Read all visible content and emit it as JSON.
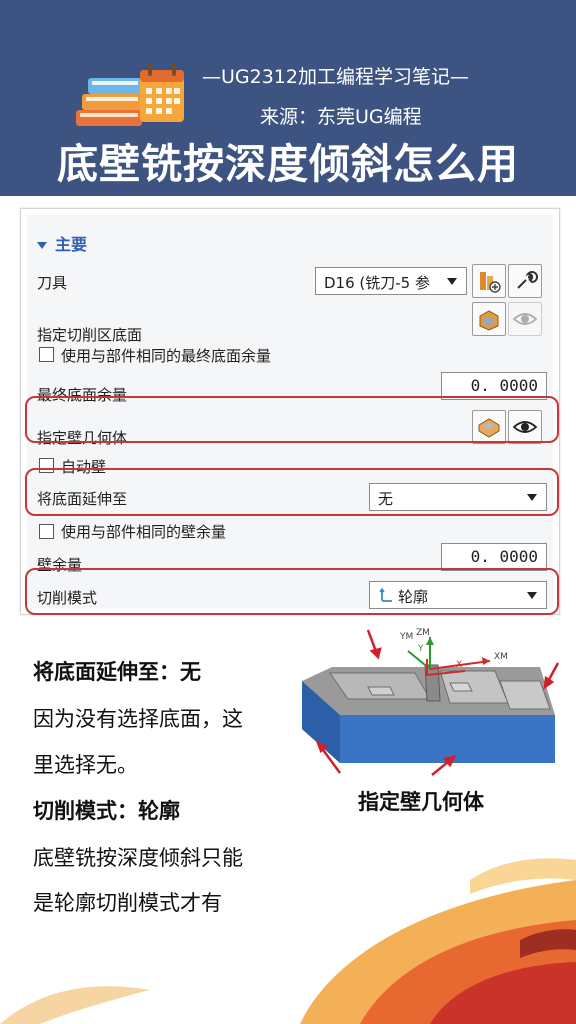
{
  "header": {
    "line1": "—UG2312加工编程学习笔记—",
    "line2": "来源：东莞UG编程",
    "title": "底壁铣按深度倾斜怎么用"
  },
  "panel": {
    "section": "主要",
    "tool_label": "刀具",
    "tool_value": "D16 (铣刀-5 参",
    "floor_label": "指定切削区底面",
    "same_floor_stock": "使用与部件相同的最终底面余量",
    "final_floor_stock_label": "最终底面余量",
    "final_floor_stock_value": "0. 0000",
    "wall_geom_label": "指定壁几何体",
    "auto_wall": "自动壁",
    "extend_label": "将底面延伸至",
    "extend_value": "无",
    "same_wall_stock": "使用与部件相同的壁余量",
    "wall_stock_label": "壁余量",
    "wall_stock_value": "0. 0000",
    "cut_mode_label": "切削模式",
    "cut_mode_value": "轮廓"
  },
  "icons": {
    "tool_new": "tool-new-icon",
    "tool_edit": "wrench-icon",
    "floor_select": "floor-select-icon",
    "display": "eye-icon",
    "wall_select": "wall-select-icon",
    "cut_mode": "contour-icon",
    "dropdown": "chevron-down-icon"
  },
  "notes": {
    "h1": "将底面延伸至：无",
    "p1a": "因为没有选择底面，这",
    "p1b": "里选择无。",
    "h2": "切削模式：轮廓",
    "p2a": "底壁铣按深度倾斜只能",
    "p2b": "是轮廓切削模式才有"
  },
  "figure": {
    "caption": "指定壁几何体",
    "axis_labels": [
      "YM",
      "ZM",
      "XM",
      "X",
      "Y"
    ]
  },
  "colors": {
    "header_bg": "#3d5382",
    "accent_blue": "#2f5fb6",
    "highlight_red": "#c9363a",
    "model_blue": "#3a74c4"
  }
}
